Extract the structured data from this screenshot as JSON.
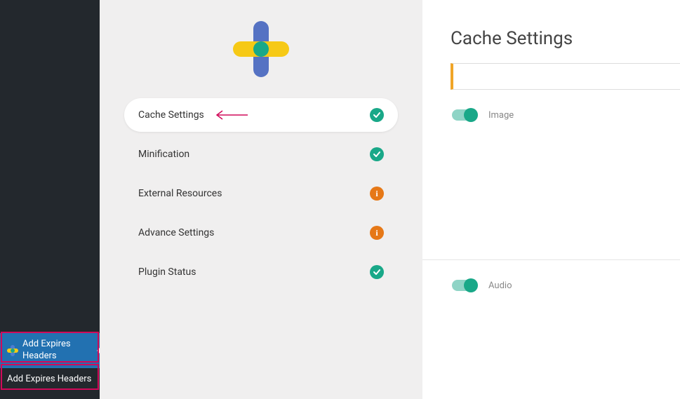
{
  "wp_sidebar": {
    "menu_item": "Add Expires Headers",
    "submenu_item": "Add Expires Headers"
  },
  "plugin": {
    "nav": [
      {
        "label": "Cache Settings",
        "status": "ok",
        "active": true
      },
      {
        "label": "Minification",
        "status": "ok",
        "active": false
      },
      {
        "label": "External Resources",
        "status": "warn",
        "active": false
      },
      {
        "label": "Advance Settings",
        "status": "warn",
        "active": false
      },
      {
        "label": "Plugin Status",
        "status": "ok",
        "active": false
      }
    ]
  },
  "content": {
    "title": "Cache Settings",
    "toggles": [
      {
        "label": "Image",
        "enabled": true
      },
      {
        "label": "Audio",
        "enabled": true
      }
    ]
  }
}
